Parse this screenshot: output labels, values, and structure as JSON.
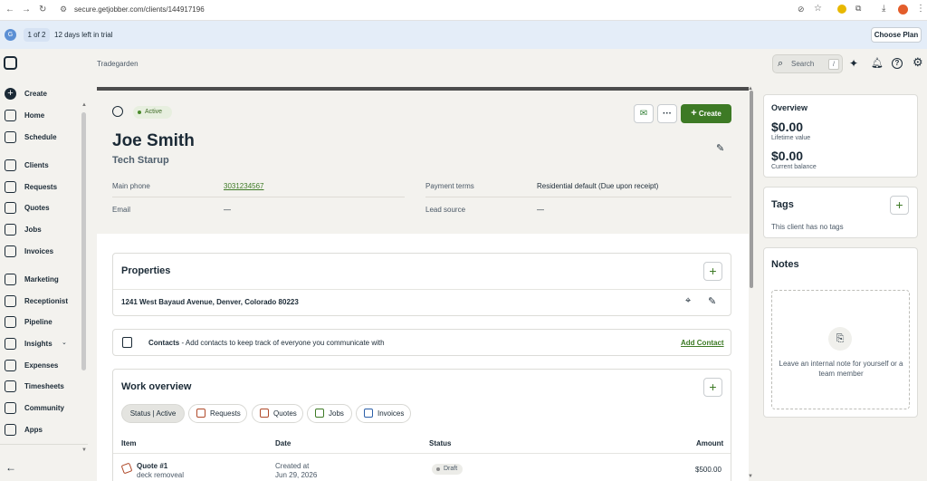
{
  "browser": {
    "url": "secure.getjobber.com/clients/144917196"
  },
  "trial": {
    "icon": "G",
    "pill": "1 of 2",
    "text": "12 days left in trial",
    "choose_plan": "Choose Plan"
  },
  "sidebar": {
    "create": "Create",
    "items": [
      {
        "label": "Home",
        "icon": "home-icon"
      },
      {
        "label": "Schedule",
        "icon": "calendar-icon"
      },
      {
        "label": "Clients",
        "icon": "clients-icon"
      },
      {
        "label": "Requests",
        "icon": "requests-icon"
      },
      {
        "label": "Quotes",
        "icon": "quotes-icon"
      },
      {
        "label": "Jobs",
        "icon": "jobs-icon"
      },
      {
        "label": "Invoices",
        "icon": "invoices-icon"
      },
      {
        "label": "Marketing",
        "icon": "marketing-icon"
      },
      {
        "label": "Receptionist",
        "icon": "receptionist-icon"
      },
      {
        "label": "Pipeline",
        "icon": "pipeline-icon"
      },
      {
        "label": "Insights",
        "icon": "insights-icon"
      },
      {
        "label": "Expenses",
        "icon": "expenses-icon"
      },
      {
        "label": "Timesheets",
        "icon": "timesheets-icon"
      },
      {
        "label": "Community",
        "icon": "community-icon"
      },
      {
        "label": "Apps",
        "icon": "apps-icon"
      }
    ]
  },
  "header": {
    "breadcrumb": "Tradegarden",
    "search_placeholder": "Search",
    "search_shortcut": "/"
  },
  "client": {
    "status": "Active",
    "name": "Joe Smith",
    "company": "Tech Starup",
    "create_label": "Create",
    "main_phone_label": "Main phone",
    "main_phone": "3031234567",
    "email_label": "Email",
    "email": "—",
    "payment_terms_label": "Payment terms",
    "payment_terms": "Residential default (Due upon receipt)",
    "lead_source_label": "Lead source",
    "lead_source": "—"
  },
  "properties": {
    "title": "Properties",
    "address": "1241 West Bayaud Avenue, Denver, Colorado 80223"
  },
  "contacts": {
    "title": "Contacts",
    "description": " - Add contacts to keep track of everyone you communicate with",
    "add_label": "Add Contact"
  },
  "work": {
    "title": "Work overview",
    "tabs": [
      "Status | Active",
      "Requests",
      "Quotes",
      "Jobs",
      "Invoices"
    ],
    "columns": [
      "Item",
      "Date",
      "Status",
      "Amount"
    ],
    "rows": [
      {
        "item": "Quote #1",
        "sub": "deck removeal",
        "date_label": "Created at",
        "date": "Jun 29, 2026",
        "status": "Draft",
        "amount": "$500.00"
      }
    ]
  },
  "overview": {
    "title": "Overview",
    "lifetime": "$0.00",
    "lifetime_label": "Lifetime value",
    "balance": "$0.00",
    "balance_label": "Current balance"
  },
  "tags": {
    "title": "Tags",
    "empty": "This client has no tags"
  },
  "notes": {
    "title": "Notes",
    "empty": "Leave an internal note for yourself or a team member"
  },
  "colors": {
    "brand_green": "#3d7a25",
    "banner_blue": "#e4edf8"
  }
}
